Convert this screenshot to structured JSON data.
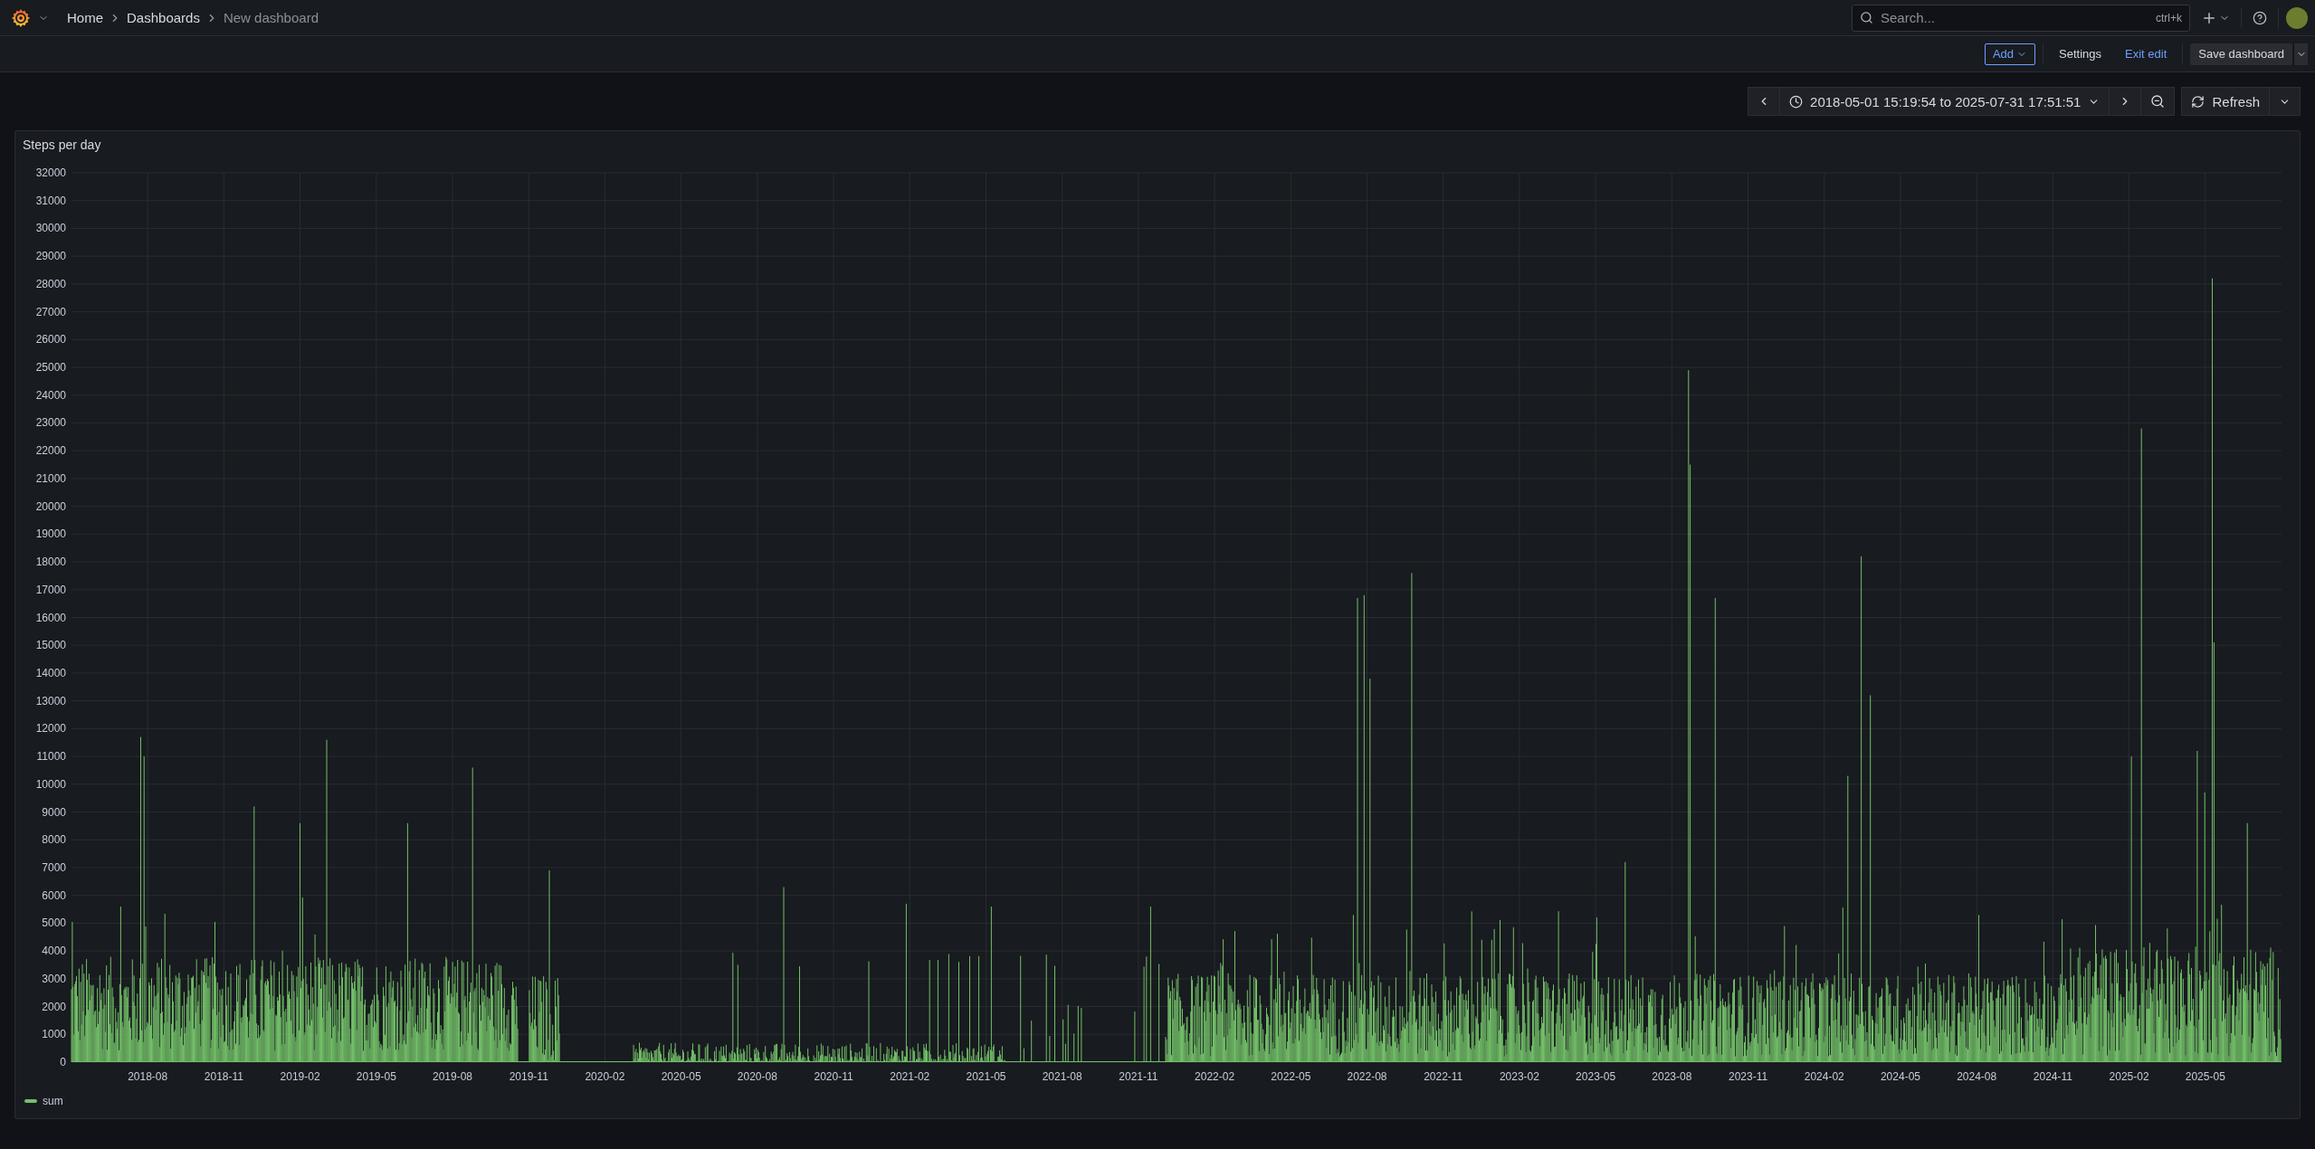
{
  "breadcrumbs": [
    {
      "label": "Home",
      "current": false
    },
    {
      "label": "Dashboards",
      "current": false
    },
    {
      "label": "New dashboard",
      "current": true
    }
  ],
  "search": {
    "placeholder": "Search...",
    "shortcut": "ctrl+k"
  },
  "edit_toolbar": [
    {
      "label": "Add",
      "kind": "add"
    },
    {
      "label": "Settings",
      "kind": "plain"
    },
    {
      "label": "Exit edit",
      "kind": "link"
    },
    {
      "label": "Save dashboard",
      "kind": "save"
    }
  ],
  "time_range": {
    "label": "2018-05-01 15:19:54 to 2025-07-31 17:51:51"
  },
  "refresh": {
    "label": "Refresh"
  },
  "panel": {
    "title": "Steps per day",
    "y_axis_labels": [
      "32000",
      "31000",
      "30000",
      "29000",
      "28000",
      "27000",
      "26000",
      "25000",
      "24000",
      "23000",
      "22000",
      "21000",
      "20000",
      "19000",
      "18000",
      "17000",
      "16000",
      "15000",
      "14000",
      "13000",
      "12000",
      "11000",
      "10000",
      "9000",
      "8000",
      "7000",
      "6000",
      "5000",
      "4000",
      "3000",
      "2000",
      "1000",
      "0"
    ],
    "x_axis_labels": [
      "2018-08",
      "2018-11",
      "2019-02",
      "2019-05",
      "2019-08",
      "2019-11",
      "2020-02",
      "2020-05",
      "2020-08",
      "2020-11",
      "2021-02",
      "2021-05",
      "2021-08",
      "2021-11",
      "2022-02",
      "2022-05",
      "2022-08",
      "2022-11",
      "2023-02",
      "2023-05",
      "2023-08",
      "2023-11",
      "2024-02",
      "2024-05",
      "2024-08",
      "2024-11",
      "2025-02",
      "2025-05"
    ],
    "legend": [
      {
        "label": "sum",
        "color": "#73bf69"
      }
    ]
  }
}
